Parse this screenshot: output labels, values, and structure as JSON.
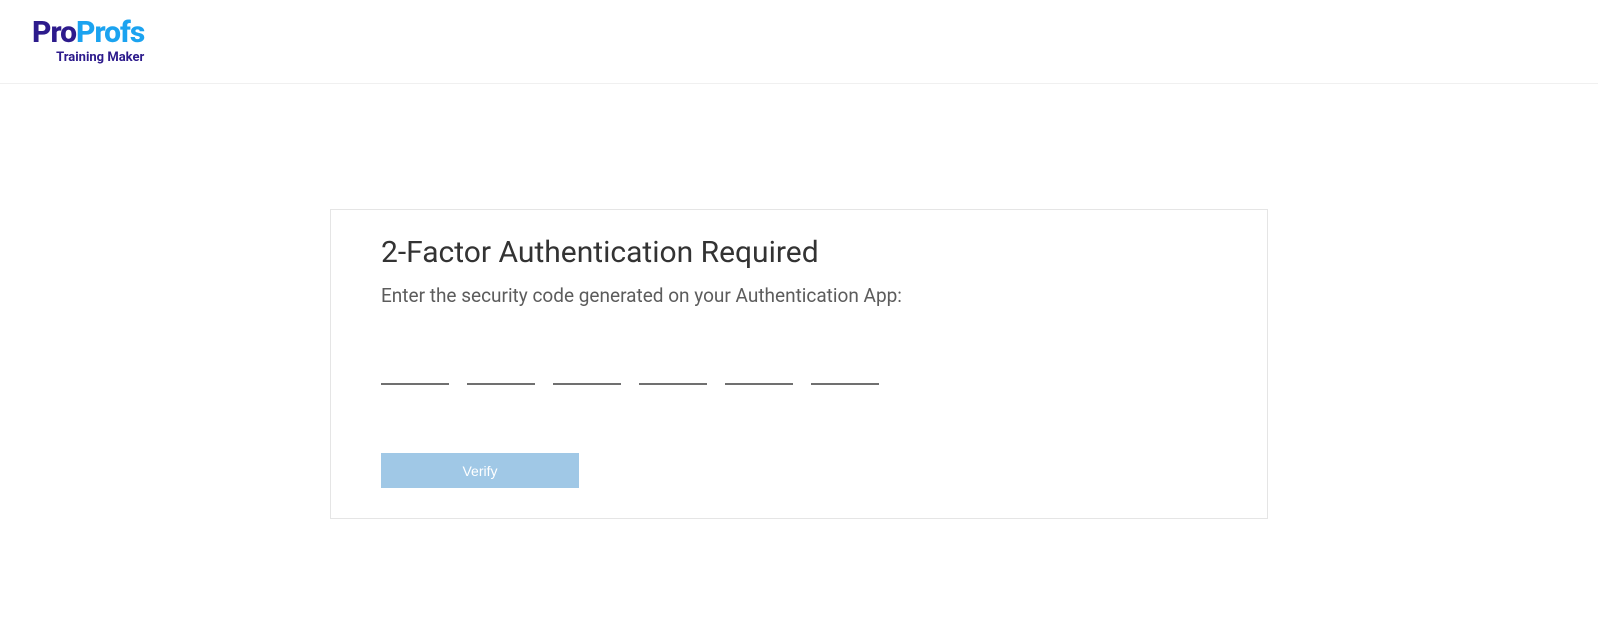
{
  "logo": {
    "part1": "Pro",
    "part2": "Profs",
    "subtitle": "Training Maker"
  },
  "card": {
    "title": "2-Factor Authentication Required",
    "subtitle": "Enter the security code generated on your Authentication App:",
    "verify_button": "Verify"
  },
  "code_inputs": {
    "count": 6,
    "values": [
      "",
      "",
      "",
      "",
      "",
      ""
    ]
  }
}
